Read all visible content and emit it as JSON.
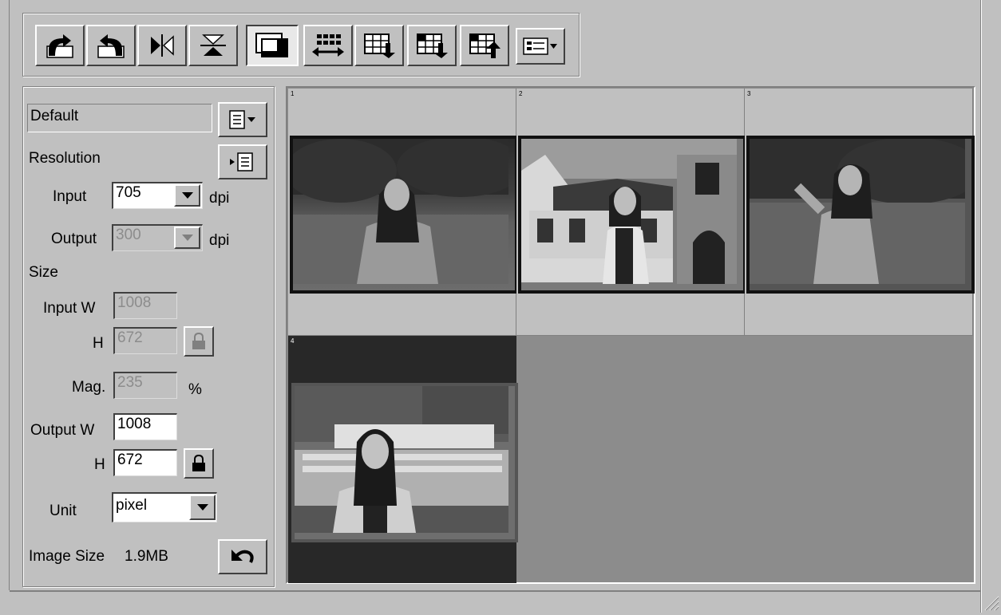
{
  "toolbar": {
    "buttons": [
      {
        "name": "rotate-left-button",
        "icon": "rotate-left-icon"
      },
      {
        "name": "rotate-right-button",
        "icon": "rotate-right-icon"
      },
      {
        "name": "flip-horizontal-button",
        "icon": "flip-horizontal-icon"
      },
      {
        "name": "flip-vertical-button",
        "icon": "flip-vertical-icon"
      },
      {
        "name": "frame-view-button",
        "icon": "frame-icon"
      },
      {
        "name": "fit-width-button",
        "icon": "expand-horizontal-icon"
      },
      {
        "name": "scan-all-button",
        "icon": "grid-arrow-icon"
      },
      {
        "name": "scan-selected-button",
        "icon": "grid-arrow-icon"
      },
      {
        "name": "rescan-button",
        "icon": "grid-arrow-up-icon"
      },
      {
        "name": "view-options-dropdown",
        "icon": "list-dropdown-icon"
      }
    ]
  },
  "settings": {
    "preset_value": "Default",
    "resolution_label": "Resolution",
    "input_label": "Input",
    "input_dpi": "705",
    "output_label": "Output",
    "output_dpi": "300",
    "dpi_unit": "dpi",
    "size_label": "Size",
    "input_w_label": "Input W",
    "input_w": "1008",
    "h_label": "H",
    "input_h": "672",
    "mag_label": "Mag.",
    "mag_value": "235",
    "percent_unit": "%",
    "output_w_label": "Output W",
    "output_w": "1008",
    "output_h": "672",
    "unit_label": "Unit",
    "unit_value": "pixel",
    "image_size_label": "Image Size",
    "image_size_value": "1.9MB"
  },
  "thumbnails": [
    {
      "number": "1",
      "selected": false
    },
    {
      "number": "2",
      "selected": false
    },
    {
      "number": "3",
      "selected": false
    },
    {
      "number": "4",
      "selected": true
    }
  ],
  "colors": {
    "face": "#c0c0c0",
    "selected_cell": "#282828",
    "empty_area": "#8c8c8c"
  }
}
